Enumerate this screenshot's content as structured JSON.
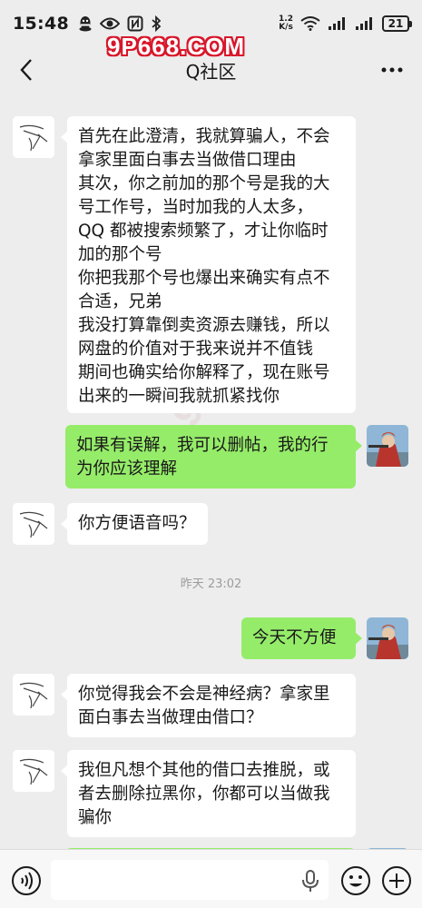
{
  "status_bar": {
    "time": "15:48",
    "net_speed_value": "1.2",
    "net_speed_unit": "K/s",
    "battery": "21",
    "left_icons": [
      "qq-icon",
      "eye-icon",
      "nfc-icon",
      "bluetooth-icon"
    ],
    "right_icons": [
      "wifi-icon",
      "signal-icon",
      "signal-icon",
      "battery-icon"
    ]
  },
  "watermark": "9P668.COM",
  "watermark_diag": "9P668.COM",
  "header": {
    "title": "Q社区"
  },
  "messages": [
    {
      "side": "in",
      "lines": [
        "首先在此澄清，我就算骗人，不会",
        "拿家里面白事去当做借口理由",
        "其次，你之前加的那个号是我的大",
        "号工作号，当时加我的人太多，",
        "QQ 都被搜索频繁了，才让你临时",
        "加的那个号",
        "你把我那个号也爆出来确实有点不",
        "合适，兄弟",
        "我没打算靠倒卖资源去赚钱，所以",
        "网盘的价值对于我来说并不值钱",
        "期间也确实给你解释了，现在账号",
        "出来的一瞬间我就抓紧找你"
      ]
    },
    {
      "side": "out",
      "lines": [
        "如果有误解，我可以删帖，我的行",
        "为你应该理解"
      ]
    },
    {
      "side": "in",
      "lines": [
        "你方便语音吗？"
      ]
    },
    {
      "side": "out",
      "lines": [
        "今天不方便"
      ]
    },
    {
      "side": "in",
      "lines": [
        "你觉得我会不会是神经病？拿家里",
        "面白事去当做理由借口？"
      ]
    },
    {
      "side": "in",
      "lines": [
        "我但凡想个其他的借口去推脱，或",
        "者去删除拉黑你，你都可以当做我",
        "骗你"
      ]
    }
  ],
  "timestamp": "昨天 23:02",
  "input_bar": {
    "placeholder": ""
  },
  "colors": {
    "background": "#ededed",
    "bubble_in": "#ffffff",
    "bubble_out": "#95ec69",
    "watermark_red": "#d8162a"
  }
}
